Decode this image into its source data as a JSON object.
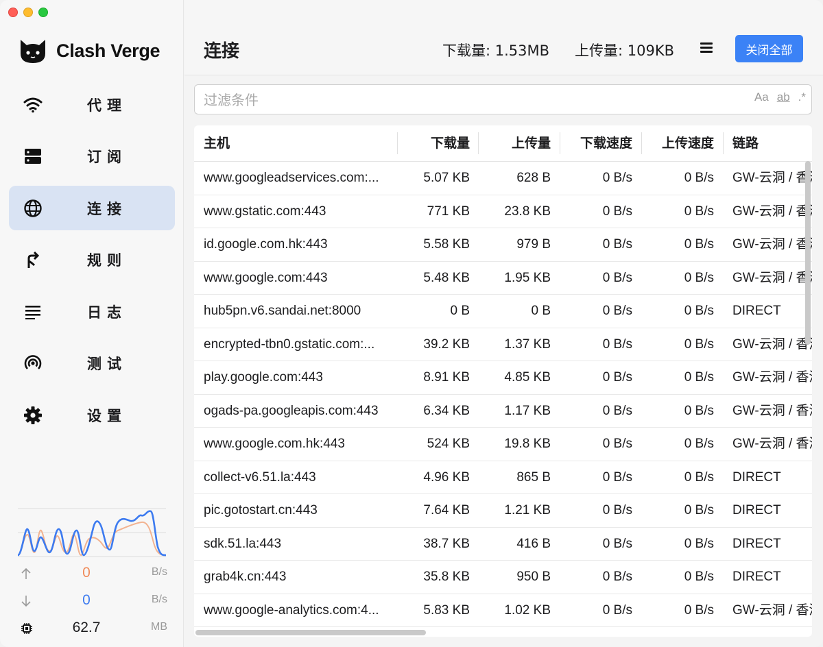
{
  "app": {
    "name": "Clash Verge"
  },
  "sidebar": {
    "items": [
      {
        "label": "代理",
        "icon": "wifi-icon"
      },
      {
        "label": "订阅",
        "icon": "server-icon"
      },
      {
        "label": "连接",
        "icon": "globe-icon",
        "active": true
      },
      {
        "label": "规则",
        "icon": "fork-icon"
      },
      {
        "label": "日志",
        "icon": "list-icon"
      },
      {
        "label": "测试",
        "icon": "radar-icon"
      },
      {
        "label": "设置",
        "icon": "gear-icon"
      }
    ],
    "stats": {
      "up_value": "0",
      "up_unit": "B/s",
      "down_value": "0",
      "down_unit": "B/s",
      "memory_value": "62.7",
      "memory_unit": "MB"
    }
  },
  "header": {
    "title": "连接",
    "download_total": "下载量: 1.53MB",
    "upload_total": "上传量: 109KB",
    "close_all_label": "关闭全部"
  },
  "filter": {
    "placeholder": "过滤条件",
    "value": "",
    "options": [
      "Aa",
      "ab",
      ".*"
    ]
  },
  "table": {
    "columns": [
      "主机",
      "下载量",
      "上传量",
      "下载速度",
      "上传速度",
      "链路"
    ],
    "rows": [
      {
        "host": "www.googleadservices.com:...",
        "dl": "5.07 KB",
        "ul": "628 B",
        "dls": "0 B/s",
        "uls": "0 B/s",
        "chain": "GW-云洞 / 香港"
      },
      {
        "host": "www.gstatic.com:443",
        "dl": "771 KB",
        "ul": "23.8 KB",
        "dls": "0 B/s",
        "uls": "0 B/s",
        "chain": "GW-云洞 / 香港"
      },
      {
        "host": "id.google.com.hk:443",
        "dl": "5.58 KB",
        "ul": "979 B",
        "dls": "0 B/s",
        "uls": "0 B/s",
        "chain": "GW-云洞 / 香港"
      },
      {
        "host": "www.google.com:443",
        "dl": "5.48 KB",
        "ul": "1.95 KB",
        "dls": "0 B/s",
        "uls": "0 B/s",
        "chain": "GW-云洞 / 香港"
      },
      {
        "host": "hub5pn.v6.sandai.net:8000",
        "dl": "0 B",
        "ul": "0 B",
        "dls": "0 B/s",
        "uls": "0 B/s",
        "chain": "DIRECT"
      },
      {
        "host": "encrypted-tbn0.gstatic.com:...",
        "dl": "39.2 KB",
        "ul": "1.37 KB",
        "dls": "0 B/s",
        "uls": "0 B/s",
        "chain": "GW-云洞 / 香港"
      },
      {
        "host": "play.google.com:443",
        "dl": "8.91 KB",
        "ul": "4.85 KB",
        "dls": "0 B/s",
        "uls": "0 B/s",
        "chain": "GW-云洞 / 香港"
      },
      {
        "host": "ogads-pa.googleapis.com:443",
        "dl": "6.34 KB",
        "ul": "1.17 KB",
        "dls": "0 B/s",
        "uls": "0 B/s",
        "chain": "GW-云洞 / 香港"
      },
      {
        "host": "www.google.com.hk:443",
        "dl": "524 KB",
        "ul": "19.8 KB",
        "dls": "0 B/s",
        "uls": "0 B/s",
        "chain": "GW-云洞 / 香港"
      },
      {
        "host": "collect-v6.51.la:443",
        "dl": "4.96 KB",
        "ul": "865 B",
        "dls": "0 B/s",
        "uls": "0 B/s",
        "chain": "DIRECT"
      },
      {
        "host": "pic.gotostart.cn:443",
        "dl": "7.64 KB",
        "ul": "1.21 KB",
        "dls": "0 B/s",
        "uls": "0 B/s",
        "chain": "DIRECT"
      },
      {
        "host": "sdk.51.la:443",
        "dl": "38.7 KB",
        "ul": "416 B",
        "dls": "0 B/s",
        "uls": "0 B/s",
        "chain": "DIRECT"
      },
      {
        "host": "grab4k.cn:443",
        "dl": "35.8 KB",
        "ul": "950 B",
        "dls": "0 B/s",
        "uls": "0 B/s",
        "chain": "DIRECT"
      },
      {
        "host": "www.google-analytics.com:4...",
        "dl": "5.83 KB",
        "ul": "1.02 KB",
        "dls": "0 B/s",
        "uls": "0 B/s",
        "chain": "GW-云洞 / 香港"
      }
    ]
  },
  "colors": {
    "accent": "#3b82f6",
    "nav_active_bg": "#d9e3f3",
    "upload_color": "#f08b5a",
    "download_color": "#3d7bf0"
  }
}
